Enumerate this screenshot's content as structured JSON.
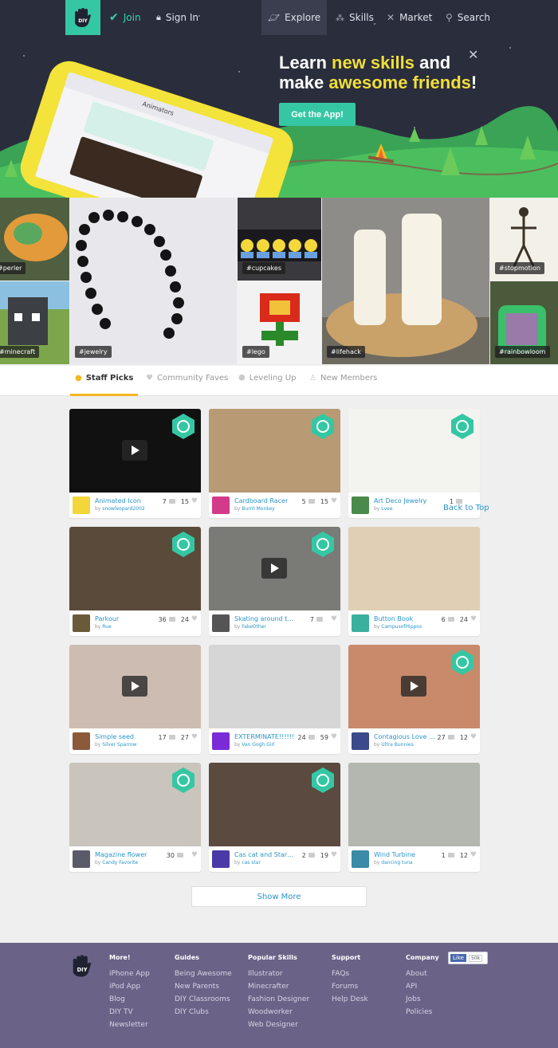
{
  "nav": {
    "join": "Join",
    "sign_in": "Sign In",
    "explore": "Explore",
    "skills": "Skills",
    "market": "Market",
    "search": "Search",
    "logo": "DIY"
  },
  "hero": {
    "line1_a": "Learn ",
    "line1_hl": "new skills",
    "line1_b": " and",
    "line2_a": "make ",
    "line2_hl": "awesome friends",
    "line2_b": "!",
    "cta": "Get the App!",
    "close": "✕",
    "phone_header": "Animators"
  },
  "tiles": [
    "#perler",
    "#minecraft",
    "#jewelry",
    "#cupcakes",
    "#lego",
    "#lifehack",
    "#stopmotion",
    "#rainbowloom"
  ],
  "tabs": [
    "Staff Picks",
    "Community Faves",
    "Leveling Up",
    "New Members"
  ],
  "cards": [
    {
      "title": "Animated Icon",
      "user": "snowleopard2002",
      "comments": "7",
      "likes": "15"
    },
    {
      "title": "Cardboard Racer",
      "user": "Burnt Monkey",
      "comments": "5",
      "likes": "15"
    },
    {
      "title": "Art Deco Jewelry",
      "user": "Lvee",
      "comments": "1",
      "likes": ""
    },
    {
      "title": "Parkour",
      "user": "Rue",
      "comments": "36",
      "likes": "24"
    },
    {
      "title": "Skating around t…",
      "user": "FakeOther",
      "comments": "7",
      "likes": ""
    },
    {
      "title": "Button Book",
      "user": "CampusofHippos",
      "comments": "6",
      "likes": "24"
    },
    {
      "title": "Simple seed",
      "user": "Silver Sparrow",
      "comments": "17",
      "likes": "27"
    },
    {
      "title": "EXTERMINATE!!!!!!",
      "user": "Van Gogh Girl",
      "comments": "24",
      "likes": "59"
    },
    {
      "title": "Contagious Love …",
      "user": "Ultra Bunnies",
      "comments": "27",
      "likes": "12"
    },
    {
      "title": "Magazine flower",
      "user": "Candy Favorite",
      "comments": "30",
      "likes": ""
    },
    {
      "title": "Cas cat and Star…",
      "user": "cas star",
      "comments": "2",
      "likes": "19"
    },
    {
      "title": "Wind Turbine",
      "user": "dancing tuna",
      "comments": "1",
      "likes": "12"
    }
  ],
  "by_prefix": "by",
  "back_to_top": "Back to Top",
  "show_more": "Show More",
  "footer": {
    "logo": "DIY",
    "cols": [
      {
        "head": "More!",
        "items": [
          "iPhone App",
          "iPod App",
          "Blog",
          "DIY TV",
          "Newsletter"
        ]
      },
      {
        "head": "Guides",
        "items": [
          "Being Awesome",
          "New Parents",
          "DIY Classrooms",
          "DIY Clubs"
        ]
      },
      {
        "head": "Popular Skills",
        "items": [
          "Illustrator",
          "Minecrafter",
          "Fashion Designer",
          "Woodworker",
          "Web Designer"
        ]
      },
      {
        "head": "Support",
        "items": [
          "FAQs",
          "Forums",
          "Help Desk"
        ]
      },
      {
        "head": "Company",
        "items": [
          "About",
          "API",
          "Jobs",
          "Policies"
        ]
      }
    ],
    "fb_like": "Like",
    "fb_count": "50k"
  },
  "colors": {
    "accent": "#35c7a3",
    "highlight": "#f0de3a",
    "link": "#2a96c8",
    "footer": "#6a6387",
    "tab_underline": "#f3b824"
  }
}
